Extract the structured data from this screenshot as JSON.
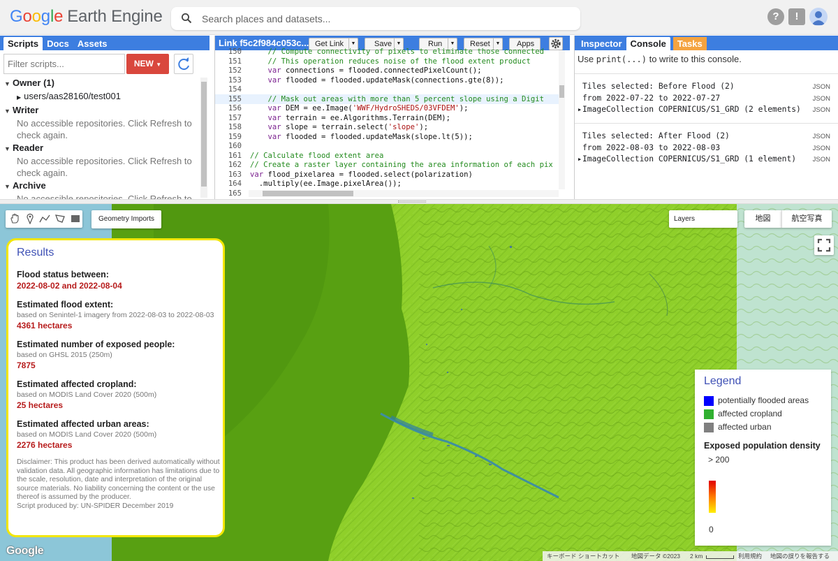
{
  "header": {
    "logo_google": [
      "G",
      "o",
      "o",
      "g",
      "l",
      "e"
    ],
    "logo_rest": "Earth Engine",
    "search_placeholder": "Search places and datasets...",
    "help_icon": "?",
    "feedback_icon": "!"
  },
  "left_panel": {
    "tabs": [
      "Scripts",
      "Docs",
      "Assets"
    ],
    "filter_placeholder": "Filter scripts...",
    "new_label": "NEW",
    "sections": [
      {
        "name": "Owner (1)",
        "items": [
          "users/aas28160/test001"
        ]
      },
      {
        "name": "Writer",
        "note": "No accessible repositories. Click Refresh to check again."
      },
      {
        "name": "Reader",
        "note": "No accessible repositories. Click Refresh to check again."
      },
      {
        "name": "Archive",
        "note": "No accessible repositories. Click Refresh to check again."
      }
    ]
  },
  "code_panel": {
    "title": "Link f5c2f984c053c...",
    "buttons": {
      "get_link": "Get Link",
      "save": "Save",
      "run": "Run",
      "reset": "Reset",
      "apps": "Apps"
    },
    "lines": [
      {
        "n": "150",
        "indent": "    ",
        "segs": [
          {
            "t": "// Compute connectivity of pixels to eliminate those connected",
            "c": "cm"
          }
        ]
      },
      {
        "n": "151",
        "indent": "    ",
        "segs": [
          {
            "t": "// This operation reduces noise of the flood extent product",
            "c": "cm"
          }
        ]
      },
      {
        "n": "152",
        "indent": "    ",
        "segs": [
          {
            "t": "var",
            "c": "kw"
          },
          {
            "t": " connections = flooded.connectedPixelCount();",
            "c": ""
          }
        ]
      },
      {
        "n": "153",
        "indent": "    ",
        "segs": [
          {
            "t": "var",
            "c": "kw"
          },
          {
            "t": " flooded = flooded.updateMask(connections.gte(8));",
            "c": ""
          }
        ]
      },
      {
        "n": "154",
        "indent": "",
        "segs": []
      },
      {
        "n": "155",
        "indent": "    ",
        "hl": true,
        "segs": [
          {
            "t": "// Mask out areas with more than 5 percent slope using a Digit",
            "c": "cm"
          }
        ]
      },
      {
        "n": "156",
        "indent": "    ",
        "segs": [
          {
            "t": "var",
            "c": "kw"
          },
          {
            "t": " DEM = ee.Image(",
            "c": ""
          },
          {
            "t": "'WWF/HydroSHEDS/03VFDEM'",
            "c": "st"
          },
          {
            "t": ");",
            "c": ""
          }
        ]
      },
      {
        "n": "157",
        "indent": "    ",
        "segs": [
          {
            "t": "var",
            "c": "kw"
          },
          {
            "t": " terrain = ee.Algorithms.Terrain(DEM);",
            "c": ""
          }
        ]
      },
      {
        "n": "158",
        "indent": "    ",
        "segs": [
          {
            "t": "var",
            "c": "kw"
          },
          {
            "t": " slope = terrain.select(",
            "c": ""
          },
          {
            "t": "'slope'",
            "c": "st"
          },
          {
            "t": ");",
            "c": ""
          }
        ]
      },
      {
        "n": "159",
        "indent": "    ",
        "segs": [
          {
            "t": "var",
            "c": "kw"
          },
          {
            "t": " flooded = flooded.updateMask(slope.lt(5));",
            "c": ""
          }
        ]
      },
      {
        "n": "160",
        "indent": "",
        "segs": []
      },
      {
        "n": "161",
        "indent": "",
        "segs": [
          {
            "t": "// Calculate flood extent area",
            "c": "cm"
          }
        ]
      },
      {
        "n": "162",
        "indent": "",
        "segs": [
          {
            "t": "// Create a raster layer containing the area information of each pix",
            "c": "cm"
          }
        ]
      },
      {
        "n": "163",
        "indent": "",
        "segs": [
          {
            "t": "var",
            "c": "kw"
          },
          {
            "t": " flood_pixelarea = flooded.select(polarization)",
            "c": ""
          }
        ]
      },
      {
        "n": "164",
        "indent": "  ",
        "segs": [
          {
            "t": ".multiply(ee.Image.pixelArea());",
            "c": ""
          }
        ]
      },
      {
        "n": "165",
        "indent": "",
        "segs": []
      }
    ]
  },
  "console_panel": {
    "tabs": [
      "Inspector",
      "Console",
      "Tasks"
    ],
    "hint_pre": "Use ",
    "hint_code": "print(...)",
    "hint_post": " to write to this console.",
    "json_label": "JSON",
    "entries": [
      {
        "lines": [
          "Tiles selected: Before Flood (2)",
          "from 2022-07-22 to 2022-07-27",
          "ImageCollection COPERNICUS/S1_GRD (2 elements)"
        ]
      },
      {
        "lines": [
          "Tiles selected: After Flood (2)",
          "from 2022-08-03 to 2022-08-03",
          "ImageCollection COPERNICUS/S1_GRD (1 element)"
        ]
      }
    ]
  },
  "map": {
    "geometry_imports": "Geometry Imports",
    "layers": "Layers",
    "map_types": [
      "地図",
      "航空写真"
    ],
    "google_logo": "Google",
    "attribution": {
      "shortcuts": "キーボード ショートカット",
      "data": "地図データ ©2023",
      "scale": "2 km",
      "terms": "利用規約",
      "report": "地図の誤りを報告する"
    },
    "results": {
      "title": "Results",
      "flood_status_label": "Flood status between:",
      "flood_status_value": "2022-08-02 and 2022-08-04",
      "extent_label": "Estimated flood extent:",
      "extent_note": "based on Senintel-1 imagery from 2022-08-03 to 2022-08-03",
      "extent_value": "4361 hectares",
      "people_label": "Estimated number of exposed people:",
      "people_note": "based on GHSL 2015 (250m)",
      "people_value": "7875",
      "cropland_label": "Estimated affected cropland:",
      "cropland_note": "based on MODIS Land Cover 2020 (500m)",
      "cropland_value": "25 hectares",
      "urban_label": "Estimated affected urban areas:",
      "urban_note": "based on MODIS Land Cover 2020 (500m)",
      "urban_value": "2276 hectares",
      "disclaimer": "Disclaimer: This product has been derived automatically without validation data. All geographic information has limitations due to the scale, resolution, date and interpretation of the original source materials. No liability concerning the content or the use thereof is assumed by the producer.",
      "credit": "Script produced by: UN-SPIDER December 2019"
    },
    "legend": {
      "title": "Legend",
      "items": [
        {
          "label": "potentially flooded areas",
          "color": "#0000ff"
        },
        {
          "label": "affected cropland",
          "color": "#30b030"
        },
        {
          "label": "affected urban",
          "color": "#808080"
        }
      ],
      "density_title": "Exposed population density",
      "density_max": "> 200",
      "density_min": "0"
    }
  }
}
